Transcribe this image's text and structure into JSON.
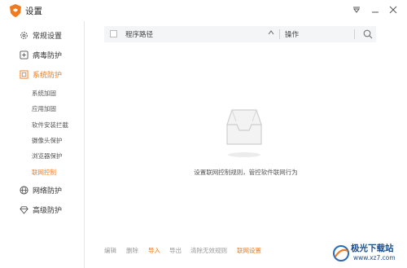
{
  "window": {
    "title": "设置"
  },
  "sidebar": {
    "items": [
      {
        "label": "常规设置",
        "icon": "gear-icon"
      },
      {
        "label": "病毒防护",
        "icon": "shield-plus-icon"
      },
      {
        "label": "系统防护",
        "icon": "system-shield-icon",
        "active": true
      },
      {
        "label": "网络防护",
        "icon": "globe-icon"
      },
      {
        "label": "高级防护",
        "icon": "diamond-icon"
      }
    ],
    "sub_items": [
      {
        "label": "系统加固"
      },
      {
        "label": "应用加固"
      },
      {
        "label": "软件安装拦截"
      },
      {
        "label": "摄像头保护"
      },
      {
        "label": "浏览器保护"
      },
      {
        "label": "联网控制",
        "active": true
      }
    ]
  },
  "table": {
    "col_path": "程序路径",
    "col_op": "操作"
  },
  "empty_state": {
    "text": "设置联网控制规则，管控软件联网行为"
  },
  "bottom_bar": {
    "edit": "编辑",
    "delete": "删除",
    "import": "导入",
    "export": "导出",
    "clear_invalid": "清除无效规则",
    "network_settings": "联网设置"
  },
  "watermark": {
    "title": "极光下载站",
    "url": "www.xz7.com"
  },
  "colors": {
    "accent": "#f07a1d",
    "header_bg": "#f4f5f7"
  }
}
